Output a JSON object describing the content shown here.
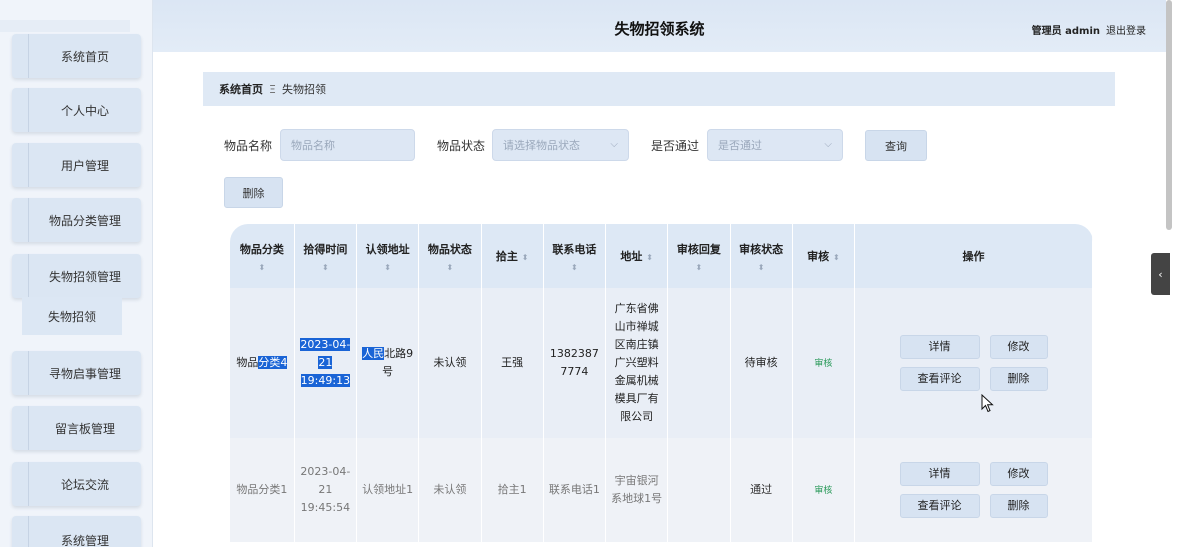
{
  "app": {
    "title": "失物招领系统",
    "user_label": "管理员 admin",
    "logout_label": "退出登录"
  },
  "sidebar": {
    "items": [
      {
        "label": "系统首页"
      },
      {
        "label": "个人中心"
      },
      {
        "label": "用户管理"
      },
      {
        "label": "物品分类管理"
      },
      {
        "label": "失物招领管理"
      },
      {
        "label": "寻物启事管理"
      },
      {
        "label": "留言板管理"
      },
      {
        "label": "论坛交流"
      },
      {
        "label": "系统管理"
      }
    ],
    "active_submenu": "失物招领"
  },
  "breadcrumb": {
    "home": "系统首页",
    "separator": "Ξ",
    "current": "失物招领"
  },
  "filters": {
    "name_label": "物品名称",
    "name_placeholder": "物品名称",
    "status_label": "物品状态",
    "status_placeholder": "请选择物品状态",
    "approved_label": "是否通过",
    "approved_placeholder": "是否通过",
    "search_button": "查询",
    "delete_button": "删除"
  },
  "table": {
    "headers": [
      "物品分类",
      "拾得时间",
      "认领地址",
      "物品状态",
      "拾主",
      "联系电话",
      "地址",
      "审核回复",
      "审核状态",
      "审核",
      "操作"
    ],
    "rows": [
      {
        "category_a": "物品",
        "category_b": "分类4",
        "time": "2023-04-21 19:49:13",
        "address_a": "人民",
        "address_b": "北路9号",
        "status": "未认领",
        "finder": "王强",
        "phone": "13823877774",
        "location": "广东省佛山市禅城区南庄镇广兴塑料金属机械模具厂有限公司",
        "reply": "",
        "audit_status": "待审核",
        "audit_link": "审核"
      },
      {
        "category": "物品分类1",
        "time": "2023-04-21 19:45:54",
        "address": "认领地址1",
        "status": "未认领",
        "finder": "拾主1",
        "phone": "联系电话1",
        "location": "宇宙银河系地球1号",
        "reply": "",
        "audit_status": "通过",
        "audit_link": "审核"
      }
    ],
    "op_labels": {
      "detail": "详情",
      "edit": "修改",
      "comments": "查看评论",
      "delete": "删除"
    }
  },
  "icons": {
    "sort": "sort-arrows-icon",
    "chevron": "chevron-down-icon",
    "collapse": "chevron-left-icon",
    "cursor": "mouse-pointer-icon"
  },
  "colors": {
    "accent": "#dbe6f3",
    "selection": "#1a64d6",
    "audit_link": "#2a9a5a"
  }
}
